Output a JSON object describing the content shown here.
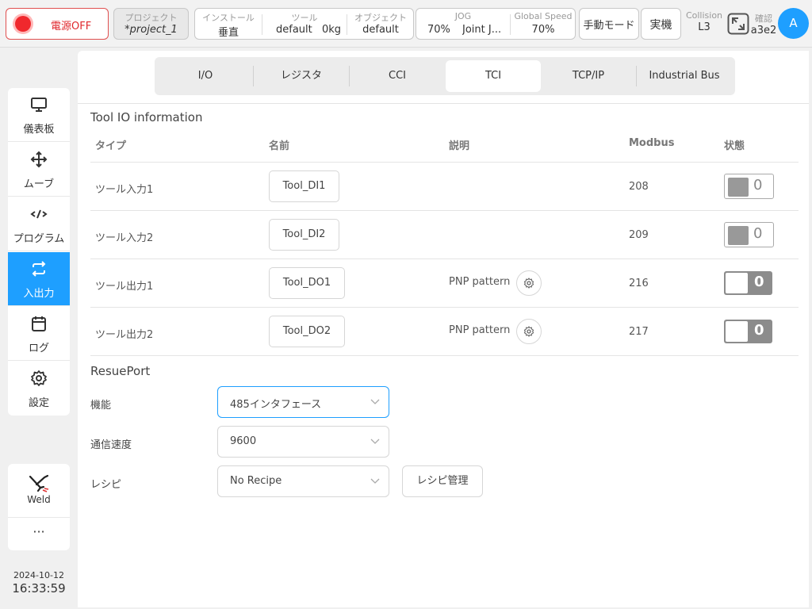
{
  "topbar": {
    "power_label": "電源OFF",
    "project": {
      "label": "プロジェクト",
      "value": "*project_1"
    },
    "install": {
      "label": "インストール",
      "value": "垂直"
    },
    "tool": {
      "label": "ツール",
      "value_name": "default",
      "value_weight": "0kg"
    },
    "object": {
      "label": "オブジェクト",
      "value": "default"
    },
    "jog": {
      "label": "JOG",
      "speed": "70%",
      "mode": "Joint J..."
    },
    "global_speed": {
      "label": "Global Speed",
      "value": "70%"
    },
    "manual_mode": "手動モード",
    "real_robot": "実機",
    "collision": {
      "label": "Collision",
      "value": "L3"
    },
    "confirm": {
      "label": "確認",
      "value": "a3e2"
    },
    "avatar_letter": "A"
  },
  "sidebar": {
    "items": [
      {
        "label": "儀表板",
        "icon": "monitor-icon"
      },
      {
        "label": "ムーブ",
        "icon": "move-arrows-icon"
      },
      {
        "label": "プログラム",
        "icon": "code-icon"
      },
      {
        "label": "入出力",
        "icon": "swap-icon",
        "active": true
      },
      {
        "label": "ログ",
        "icon": "calendar-icon"
      },
      {
        "label": "設定",
        "icon": "gear-icon"
      }
    ],
    "weld_label": "Weld",
    "more_label": "···",
    "date": "2024-10-12",
    "time": "16:33:59"
  },
  "tabs": [
    "I/O",
    "レジスタ",
    "CCI",
    "TCI",
    "TCP/IP",
    "Industrial Bus"
  ],
  "active_tab": "TCI",
  "tool_io": {
    "title": "Tool IO information",
    "headers": {
      "type": "タイプ",
      "name": "名前",
      "description": "説明",
      "modbus": "Modbus",
      "state": "状態"
    },
    "rows": [
      {
        "type": "ツール入力1",
        "name": "Tool_DI1",
        "description": "",
        "modbus": "208",
        "state": "0",
        "kind": "input"
      },
      {
        "type": "ツール入力2",
        "name": "Tool_DI2",
        "description": "",
        "modbus": "209",
        "state": "0",
        "kind": "input"
      },
      {
        "type": "ツール出力1",
        "name": "Tool_DO1",
        "description": "PNP pattern",
        "modbus": "216",
        "state": "0",
        "kind": "output"
      },
      {
        "type": "ツール出力2",
        "name": "Tool_DO2",
        "description": "PNP pattern",
        "modbus": "217",
        "state": "0",
        "kind": "output"
      }
    ]
  },
  "resue_port": {
    "title": "ResuePort",
    "function_label": "機能",
    "function_value": "485インタフェース",
    "baud_label": "通信速度",
    "baud_value": "9600",
    "recipe_label": "レシピ",
    "recipe_value": "No Recipe",
    "recipe_manage": "レシピ管理"
  },
  "colors": {
    "accent": "#1e9fff",
    "power": "#f0282d"
  }
}
